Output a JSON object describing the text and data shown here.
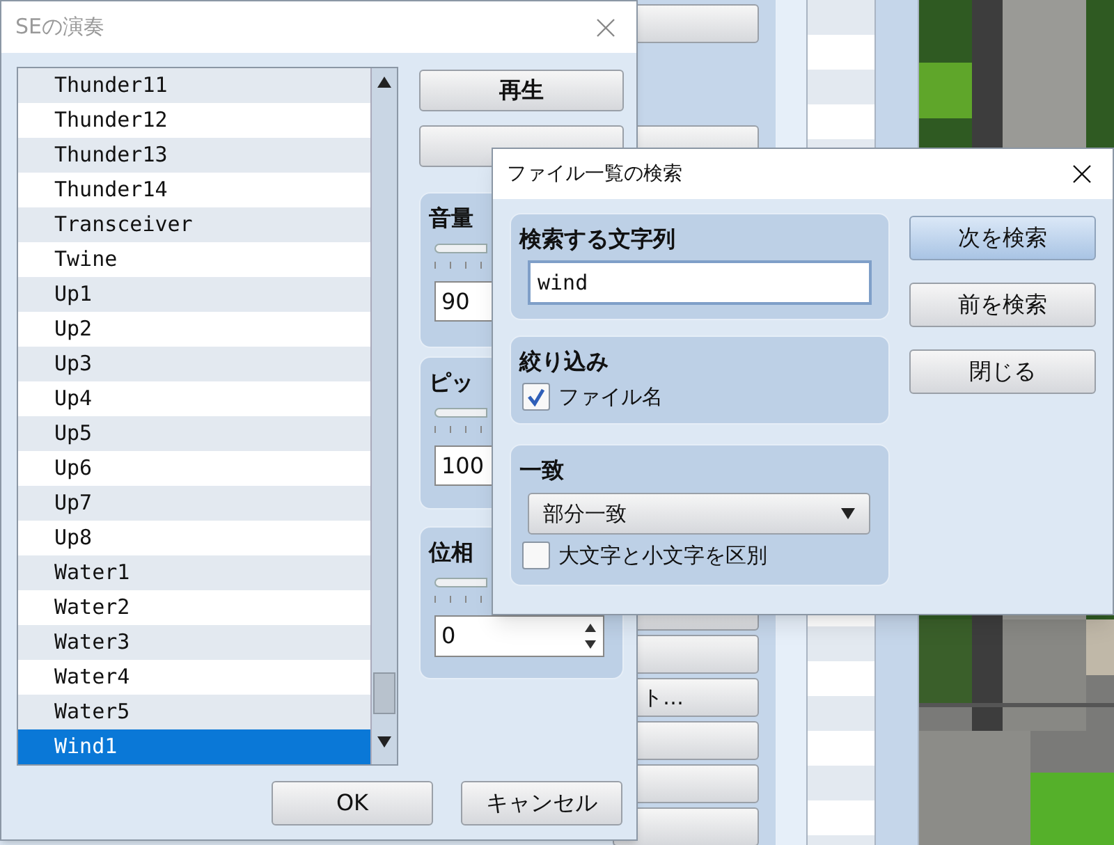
{
  "background_app": {
    "buttons": [
      {
        "kind": "blank"
      },
      {
        "kind": "blank"
      },
      {
        "kind": "blank"
      },
      {
        "kind": "blank"
      },
      {
        "kind": "labeled",
        "label": "ト…"
      },
      {
        "kind": "blank"
      },
      {
        "kind": "blank"
      },
      {
        "kind": "blank"
      }
    ]
  },
  "se_dialog": {
    "title": "SEの演奏",
    "active": false,
    "list": [
      {
        "name": "Thunder11",
        "selected": false
      },
      {
        "name": "Thunder12",
        "selected": false
      },
      {
        "name": "Thunder13",
        "selected": false
      },
      {
        "name": "Thunder14",
        "selected": false
      },
      {
        "name": "Transceiver",
        "selected": false
      },
      {
        "name": "Twine",
        "selected": false
      },
      {
        "name": "Up1",
        "selected": false
      },
      {
        "name": "Up2",
        "selected": false
      },
      {
        "name": "Up3",
        "selected": false
      },
      {
        "name": "Up4",
        "selected": false
      },
      {
        "name": "Up5",
        "selected": false
      },
      {
        "name": "Up6",
        "selected": false
      },
      {
        "name": "Up7",
        "selected": false
      },
      {
        "name": "Up8",
        "selected": false
      },
      {
        "name": "Water1",
        "selected": false
      },
      {
        "name": "Water2",
        "selected": false
      },
      {
        "name": "Water3",
        "selected": false
      },
      {
        "name": "Water4",
        "selected": false
      },
      {
        "name": "Water5",
        "selected": false
      },
      {
        "name": "Wind1",
        "selected": true
      }
    ],
    "play_button": "再生",
    "volume": {
      "label": "音量",
      "value": "90"
    },
    "pitch": {
      "label": "ピッ",
      "value": "100"
    },
    "pan": {
      "label": "位相",
      "value": "0"
    },
    "buttons": [
      "OK",
      "キャンセル"
    ]
  },
  "search_dialog": {
    "title": "ファイル一覧の検索",
    "query": {
      "label": "検索する文字列",
      "value": "wind"
    },
    "filter": {
      "label": "絞り込み",
      "options": [
        {
          "label": "ファイル名",
          "checked": true
        }
      ]
    },
    "match": {
      "label": "一致",
      "mode": "部分一致",
      "options": [
        {
          "label": "大文字と小文字を区別",
          "checked": false
        }
      ]
    },
    "buttons": [
      {
        "label": "次を検索",
        "default": true
      },
      {
        "label": "前を検索",
        "default": false
      },
      {
        "label": "閉じる",
        "default": false
      }
    ]
  }
}
